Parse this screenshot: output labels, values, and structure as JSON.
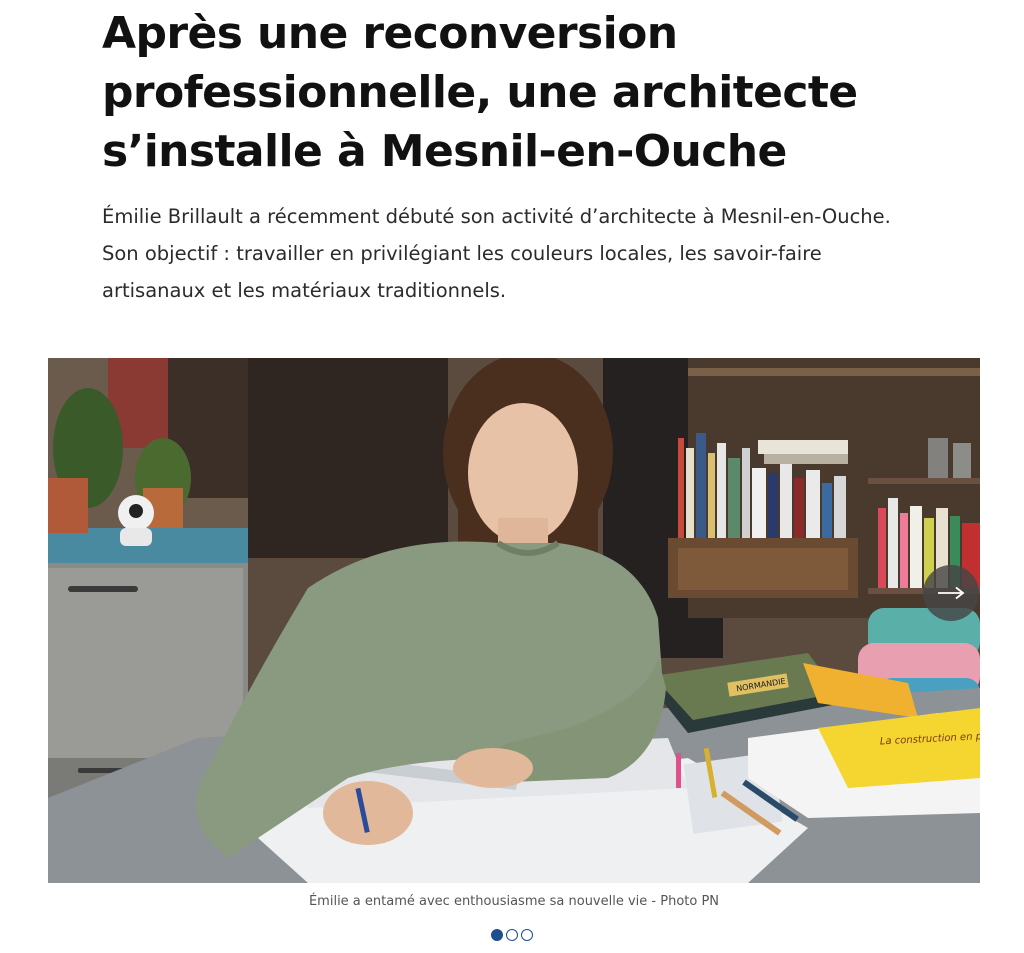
{
  "article": {
    "headline": "Après une reconversion professionnelle, une architecte s’installe à Mesnil-en-Ouche",
    "lede": "Émilie Brillault a récemment débuté son activité d’architecte à Mesnil-en-Ouche. Son objectif : travailler en privilégiant les couleurs locales, les savoir-faire artisanaux et les matériaux traditionnels."
  },
  "gallery": {
    "caption": "Émilie a entamé avec enthousiasme sa nouvelle vie - Photo PN",
    "next_icon": "arrow-right-icon",
    "slide_count": 3,
    "active_slide": 1,
    "book_title": "NORMANDIE",
    "book_title_2": "La construction en pa"
  },
  "colors": {
    "accent": "#1f4f8f",
    "sweater": "#8a9a80",
    "background_shelf": "#5a4434"
  }
}
